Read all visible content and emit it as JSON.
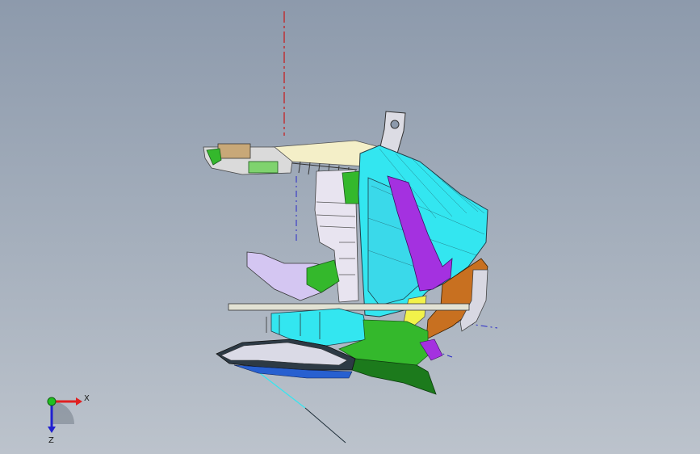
{
  "viewport": {
    "background_top": "#8d9aac",
    "background_bottom": "#bcc3cc",
    "model": "cad-assembly-section-view"
  },
  "triad": {
    "x_label": "X",
    "y_label": "",
    "z_label": "Z",
    "x_color": "#e02020",
    "y_color": "#20c020",
    "z_color": "#2020d0"
  },
  "colors": {
    "cyan": "#33e6f0",
    "purple": "#a431e0",
    "green": "#34b82c",
    "dark_green": "#1c7a1c",
    "lavender": "#c8b8ec",
    "cream": "#f4efc8",
    "tan": "#c8a878",
    "orange": "#c87020",
    "yellow": "#f2f24a",
    "blue": "#2860d0",
    "grey": "#c8c8c8",
    "axis_red": "#c81818",
    "axis_blue": "#2828c8"
  }
}
